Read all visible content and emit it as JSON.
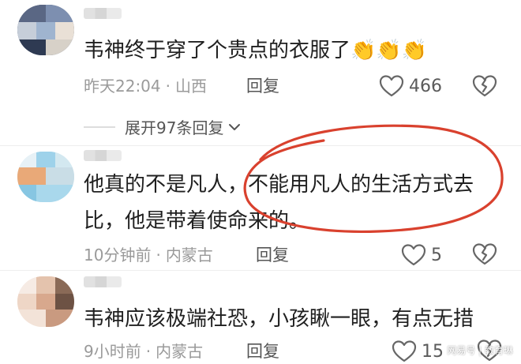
{
  "comments": [
    {
      "text": "韦神终于穿了个贵点的衣服了👏👏👏",
      "time": "昨天22:04",
      "location": "山西",
      "reply_label": "回复",
      "likes": "466"
    },
    {
      "text_line1": "他真的不是凡人，不能用凡人的生活方式去",
      "text_line2": "比，他是带着使命来的。",
      "time": "10分钟前",
      "location": "内蒙古",
      "reply_label": "回复",
      "likes": "5"
    },
    {
      "text": "韦神应该极端社恐，小孩瞅一眼，有点无措",
      "time": "9小时前",
      "location": "内蒙古",
      "reply_label": "回复",
      "likes": "15"
    }
  ],
  "expand_replies_label": "展开97条回复",
  "meta_separator": "·",
  "watermark": "网易号 | 教育琳",
  "colors": {
    "annotation_circle": "#d9412e",
    "meta_gray": "#9a9a9a",
    "icon_gray": "#666666"
  },
  "icons": {
    "like": "heart-outline-icon",
    "dislike": "broken-heart-icon",
    "expand": "chevron-down-icon"
  }
}
